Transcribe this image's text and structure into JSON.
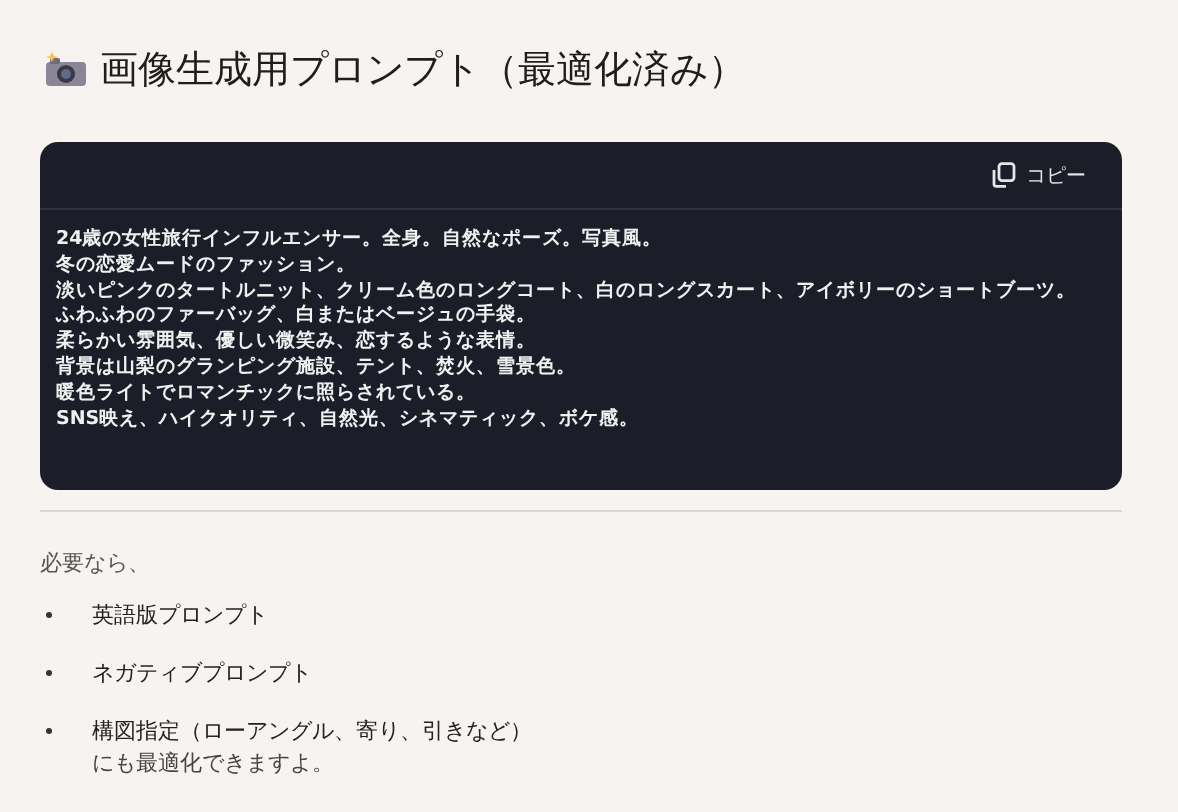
{
  "title": "画像生成用プロンプト（最適化済み）",
  "code_block": {
    "copy_label": "コピー",
    "lines": [
      "24歳の女性旅行インフルエンサー。全身。自然なポーズ。写真風。",
      "冬の恋愛ムードのファッション。",
      "淡いピンクのタートルニット、クリーム色のロングコート、白のロングスカート、アイボリーのショートブーツ。",
      "ふわふわのファーバッグ、白またはベージュの手袋。",
      "柔らかい雰囲気、優しい微笑み、恋するような表情。",
      "背景は山梨のグランピング施設、テント、焚火、雪景色。",
      "暖色ライトでロマンチックに照らされている。",
      "SNS映え、ハイクオリティ、自然光、シネマティック、ボケ感。"
    ]
  },
  "intro": "必要なら、",
  "options": [
    {
      "label": "英語版プロンプト"
    },
    {
      "label": "ネガティブプロンプト"
    },
    {
      "label": "構図指定（ローアングル、寄り、引きなど）",
      "continuation": "にも最適化できますよ。"
    }
  ]
}
